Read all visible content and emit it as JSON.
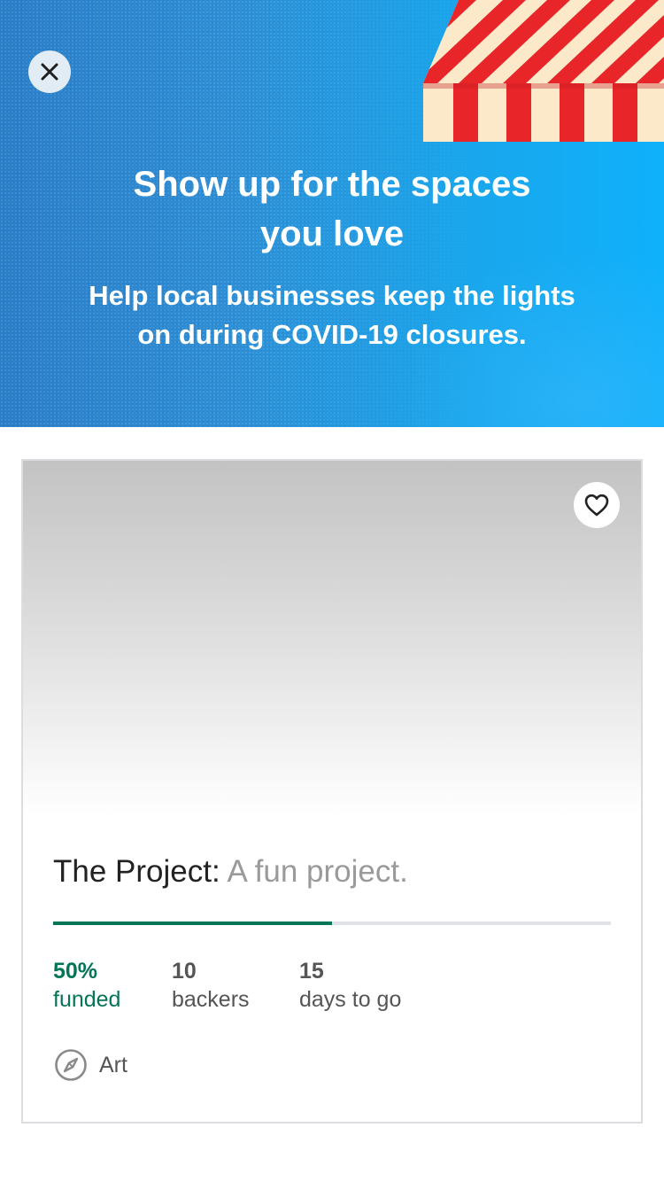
{
  "banner": {
    "title_line1": "Show up for the spaces",
    "title_line2": "you love",
    "subtitle_line1": "Help local businesses keep the lights",
    "subtitle_line2": "on during COVID-19 closures.",
    "close_icon": "close-icon",
    "illustration": "striped-awning",
    "colors": {
      "blue_dark": "#2b7fc9",
      "blue_light": "#0fb1fb",
      "awning_red": "#e8262a",
      "awning_cream": "#fbe9c9"
    }
  },
  "project_card": {
    "save_icon": "heart-icon",
    "name": "The Project:",
    "blurb": "A fun project.",
    "progress_fraction": 0.5,
    "stats": {
      "funded_value": "50%",
      "funded_label": "funded",
      "backers_value": "10",
      "backers_label": "backers",
      "days_value": "15",
      "days_label": "days to go"
    },
    "category_icon": "compass-icon",
    "category": "Art",
    "accent_color": "#057457"
  }
}
